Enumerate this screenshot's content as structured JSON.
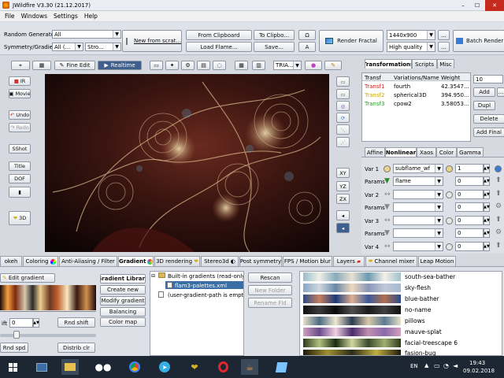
{
  "window": {
    "title": "JWildfire V3.30 (21.12.2017)",
    "minimize": "–",
    "maximize": "☐",
    "close": "✕"
  },
  "menu": [
    "File",
    "Windows",
    "Settings",
    "Help"
  ],
  "toolbar": {
    "random_generator_label": "Random Generator",
    "random_generator_value": "All",
    "symmetry_label": "Symmetry/Gradient",
    "symmetry_value": "All (...",
    "stro_value": "Stro...",
    "new_from_scratch": "New from scrat...",
    "from_clipboard": "From Clipboard",
    "to_clipboard": "To Clipbo...",
    "load_flame": "Load Flame...",
    "save": "Save...",
    "omega": "Ω",
    "a_btn": "A",
    "render_fractal": "Render Fractal",
    "resolution": "1440x900",
    "quality": "High quality",
    "dots": "...",
    "batch_render": "Batch Render"
  },
  "preview_toolbar": {
    "fine_edit": "Fine Edit",
    "realtime": "Realtime",
    "tria": "TRIA..."
  },
  "left_buttons": {
    "ir": "IR",
    "movie": "Movie",
    "undo": "Undo",
    "redo": "Redo",
    "sshot": "SShot",
    "title": "Title",
    "dof": "DOF",
    "threed": "3D"
  },
  "right_tools": {
    "xy": "XY",
    "yz": "YZ",
    "zx": "ZX"
  },
  "right_tabs": {
    "transformations": "Transformations",
    "scripts": "Scripts",
    "misc": "Misc"
  },
  "transform_table": {
    "headers": [
      "Transf",
      "Variations/Name",
      "Weight"
    ],
    "rows": [
      {
        "transf": "Transf1",
        "name": "fourth",
        "weight": "42.3547...",
        "color": "#cc2222"
      },
      {
        "transf": "Transf2",
        "name": "spherical3D",
        "weight": "394.950...",
        "color": "#c8a800"
      },
      {
        "transf": "Transf3",
        "name": "cpow2",
        "weight": "3.58053...",
        "color": "#2a9a2a"
      }
    ]
  },
  "transform_side": {
    "value": "10",
    "add": "Add",
    "add_linked": "...",
    "dupl": "Dupl",
    "delete": "Delete",
    "add_final": "Add Final"
  },
  "sub_tabs": [
    "Affine",
    "Nonlinear",
    "Xaos",
    "Color",
    "Gamma"
  ],
  "variations": [
    {
      "label": "Var 1",
      "value": "subflame_wf",
      "amount": "1"
    },
    {
      "label": "Params",
      "value": "flame",
      "amount": "0"
    },
    {
      "label": "Var 2",
      "value": "",
      "amount": "0"
    },
    {
      "label": "Params",
      "value": "",
      "amount": "0"
    },
    {
      "label": "Var 3",
      "value": "",
      "amount": "0"
    },
    {
      "label": "Params",
      "value": "",
      "amount": "0"
    },
    {
      "label": "Var 4",
      "value": "",
      "amount": "0"
    }
  ],
  "bottom_tabs": [
    "okeh",
    "Coloring",
    "Anti-Aliasing / Filter",
    "Gradient",
    "3D rendering",
    "Stereo3d",
    "Post symmetry",
    "FPS / Motion blur",
    "Layers",
    "Channel mixer",
    "Leap Motion"
  ],
  "gradient_panel": {
    "edit_gradient": "Edit gradient",
    "shift_label": "ift",
    "shift_value": "0",
    "rnd_shift": "Rnd shift",
    "rnd_spd": "Rnd spd",
    "distrib_clr": "Distrib clr",
    "library": "Gradient Library",
    "create_new": "Create new",
    "modify_gradient": "Modify gradient",
    "balancing": "Balancing",
    "color_map": "Color map",
    "tree_root": "Built-in gradients (read-only)",
    "tree_child": "flam3-palettes.xml",
    "tree_user": "(user-gradient-path is empty)",
    "rescan": "Rescan",
    "new_folder": "New Folder",
    "rename_fld": "Rename Fld"
  },
  "gradients": [
    "south-sea-bather",
    "sky-flesh",
    "blue-bather",
    "no-name",
    "pillows",
    "mauve-splat",
    "facial-treescape 6",
    "fasion-bug"
  ],
  "taskbar": {
    "lang": "EN",
    "time": "19:43",
    "date": "09.02.2018"
  },
  "colors": {
    "accent": "#3a7bd5",
    "taskbar": "#1c2733",
    "canvas": "#1a0808"
  }
}
